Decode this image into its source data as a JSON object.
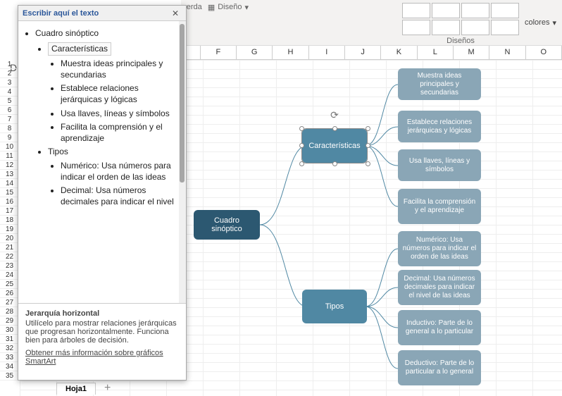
{
  "ribbon": {
    "left_fragment1": "erda",
    "diseno_button": "Diseño",
    "group_label": "Diseños",
    "colores": "colores"
  },
  "corner_letter": "D",
  "columns": [
    "F",
    "G",
    "H",
    "I",
    "J",
    "K",
    "L",
    "M",
    "N",
    "O"
  ],
  "row_count": 35,
  "text_pane": {
    "title": "Escribir aquí el texto",
    "root": "Cuadro sinóptico",
    "selected": "Características",
    "char_items": [
      "Muestra ideas principales y secundarias",
      "Establece relaciones jerárquicas y lógicas",
      "Usa llaves, líneas y símbolos",
      "Facilita la comprensión y el aprendizaje"
    ],
    "tipos_label": "Tipos",
    "tipos_items": [
      "Numérico: Usa números para indicar el orden de las ideas",
      "Decimal: Usa números decimales para indicar el nivel"
    ],
    "footer_title": "Jerarquía horizontal",
    "footer_text": "Utilícelo para mostrar relaciones jerárquicas que progresan horizontalmente. Funciona bien para árboles de decisión.",
    "footer_link": "Obtener más información sobre gráficos SmartArt"
  },
  "diagram": {
    "root": "Cuadro sinóptico",
    "caracteristicas": "Características",
    "tipos": "Tipos",
    "char_leaves": [
      "Muestra ideas principales y secundarias",
      "Establece relaciones jerárquicas y lógicas",
      "Usa llaves, líneas y símbolos",
      "Facilita la comprensión y el aprendizaje"
    ],
    "tipo_leaves": [
      "Numérico: Usa números para indicar el orden de las ideas",
      "Decimal: Usa números decimales para indicar el nivel de las ideas",
      "Inductivo: Parte de lo general a lo particular",
      "Deductivo: Parte de lo particular a lo general"
    ]
  },
  "sheet": {
    "tab": "Hoja1"
  }
}
